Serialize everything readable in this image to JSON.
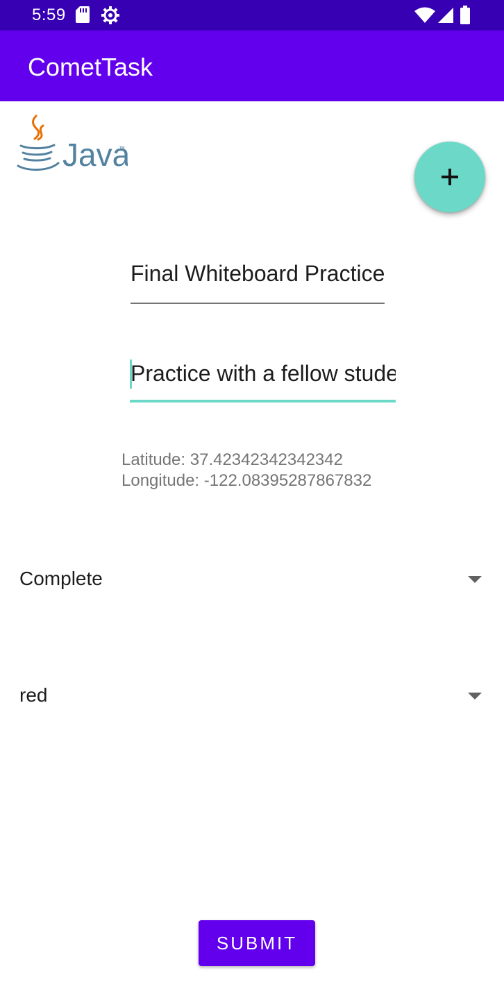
{
  "status_bar": {
    "time": "5:59",
    "left_icons": [
      "sd-card-icon",
      "settings-gear-icon"
    ],
    "right_icons": [
      "wifi-icon",
      "signal-icon",
      "battery-icon"
    ]
  },
  "app_bar": {
    "title": "CometTask",
    "color": "#6200ee"
  },
  "logo": {
    "name": "java-logo",
    "text": "Java",
    "tm": "™"
  },
  "fab": {
    "icon": "plus-icon",
    "color": "#6cd9c8"
  },
  "form": {
    "title_value": "Final Whiteboard Practice",
    "description_value": "Practice with a fellow student",
    "latitude_text": "Latitude: 37.42342342342342",
    "longitude_text": "Longitude: -122.08395287867832",
    "status_selected": "Complete",
    "color_selected": "red",
    "submit_label": "SUBMIT"
  },
  "colors": {
    "primary": "#6200ee",
    "primary_dark": "#3700b3",
    "accent": "#6cd9c8"
  }
}
